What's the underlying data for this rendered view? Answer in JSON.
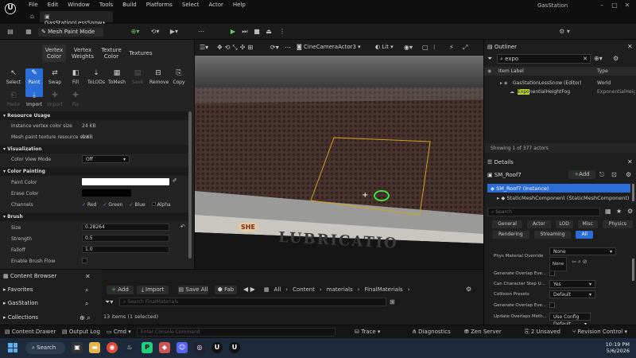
{
  "window": {
    "app_title": "GasStation",
    "doc_tab": "GasStationLessSnow•",
    "menus": [
      "File",
      "Edit",
      "Window",
      "Tools",
      "Build",
      "Platforms",
      "Select",
      "Actor",
      "Help"
    ]
  },
  "toolbar": {
    "mode": "Mesh Paint Mode"
  },
  "mode_panel": {
    "tabs": [
      "Vertex Color",
      "Vertex Weights",
      "Texture Color",
      "Textures"
    ],
    "tools_row1": [
      {
        "label": "Select",
        "icon": "cursor-icon",
        "state": "normal"
      },
      {
        "label": "Paint",
        "icon": "brush-icon",
        "state": "selected"
      },
      {
        "label": "Swap",
        "icon": "swap-icon",
        "state": "normal"
      },
      {
        "label": "Fill",
        "icon": "fill-icon",
        "state": "normal"
      },
      {
        "label": "ToLODs",
        "icon": "lods-icon",
        "state": "normal"
      },
      {
        "label": "ToMesh",
        "icon": "tomesh-icon",
        "state": "normal"
      },
      {
        "label": "Save",
        "icon": "save-icon",
        "state": "disabled"
      },
      {
        "label": "Remove",
        "icon": "remove-icon",
        "state": "normal"
      },
      {
        "label": "Copy",
        "icon": "copy-icon",
        "state": "normal"
      }
    ],
    "tools_row2": [
      {
        "label": "Paste",
        "icon": "paste-icon",
        "state": "disabled"
      },
      {
        "label": "Import",
        "icon": "import-icon",
        "state": "normal"
      },
      {
        "label": "Import",
        "icon": "fix-icon",
        "state": "disabled"
      },
      {
        "label": "Fix",
        "icon": "fix-icon",
        "state": "disabled"
      }
    ],
    "resource_usage": {
      "header": "Resource Usage",
      "vertex_color_size_label": "Instance vertex color size",
      "vertex_color_size": "24 KB",
      "texture_size_label": "Mesh paint texture resource size",
      "texture_size": "0 KB"
    },
    "visualization": {
      "header": "Visualization",
      "color_view_mode_label": "Color View Mode",
      "color_view_mode": "Off"
    },
    "color_painting": {
      "header": "Color Painting",
      "paint_color_label": "Paint Color",
      "paint_color": "#ffffff",
      "erase_color_label": "Erase Color",
      "erase_color": "#000000",
      "channels_label": "Channels",
      "channels": [
        {
          "name": "Red",
          "checked": true
        },
        {
          "name": "Green",
          "checked": true
        },
        {
          "name": "Blue",
          "checked": true
        },
        {
          "name": "Alpha",
          "checked": false
        }
      ]
    },
    "brush": {
      "header": "Brush",
      "size_label": "Size",
      "size": "0.28264",
      "strength_label": "Strength",
      "strength": "0.5",
      "falloff_label": "Falloff",
      "falloff": "1.0",
      "flow_label": "Enable Brush Flow"
    }
  },
  "viewport": {
    "camera": "CineCameraActor3",
    "view_mode": "Lit",
    "sign_text": "LUBRICATIO",
    "sign_text_small": "SHE"
  },
  "outliner": {
    "title": "Outliner",
    "search": "expo",
    "col_label": "Item Label",
    "col_type": "Type",
    "rows": [
      {
        "label": "GasStationLessSnow (Editor)",
        "type": "World",
        "indent": 1
      },
      {
        "label": "ExponentialHeightFog",
        "type": "ExponentialHeightFog",
        "indent": 2,
        "highlight": "Expo"
      }
    ],
    "footer": "Showing 1 of 377 actors"
  },
  "details": {
    "title": "Details",
    "actor_name": "SM_Roof7",
    "add_label": "Add",
    "components": [
      {
        "label": "SM_Roof7 (Instance)",
        "selected": true
      },
      {
        "label": "StaticMeshComponent (StaticMeshComponent)",
        "selected": false
      }
    ],
    "search_placeholder": "Search",
    "filter_chips_row1": [
      "General",
      "Actor",
      "LOD",
      "Misc",
      "Physics"
    ],
    "filter_chips_row2": [
      "Rendering",
      "Streaming",
      "All"
    ],
    "active_chip": "All",
    "properties": [
      {
        "label": "Phys Material Override",
        "value": "None"
      },
      {
        "label": "Generate Overlap Eve...",
        "value": ""
      },
      {
        "label": "Can Character Step U...",
        "value": "Yes"
      },
      {
        "label": "Collision Presets",
        "value": "Default"
      },
      {
        "label": "Generate Overlap Eve...",
        "value": ""
      },
      {
        "label": "Update Overlaps Meth...",
        "value": "Use Config Default"
      }
    ],
    "phys_none_1": "None",
    "phys_none_2": "None"
  },
  "content_browser": {
    "title": "Content Browser",
    "add": "Add",
    "import": "Import",
    "save_all": "Save All",
    "fab": "Fab",
    "breadcrumb": [
      "All",
      "Content",
      "materials",
      "FinalMaterials"
    ],
    "search_placeholder": "Search FinalMaterials",
    "tree": [
      "Favorites",
      "GasStation",
      "Collections"
    ],
    "status": "13 items (1 selected)"
  },
  "statusbar": {
    "content_drawer": "Content Drawer",
    "output_log": "Output Log",
    "cmd": "Cmd",
    "console_placeholder": "Enter Console Command",
    "trace": "Trace",
    "derived_data": "Diagnostics",
    "zen": "Zen Server",
    "unsaved": "2 Unsaved",
    "revision": "Revision Control"
  },
  "taskbar": {
    "search": "Search",
    "time": "10:19 PM",
    "date": "5/6/2026"
  }
}
